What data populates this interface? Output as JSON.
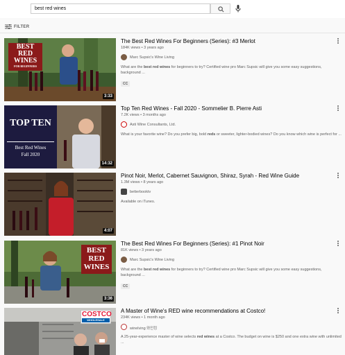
{
  "search": {
    "query": "best red wines"
  },
  "filter": {
    "label": "FILTER"
  },
  "results": [
    {
      "thumbnail_text": [
        "BEST",
        "RED",
        "WINES",
        "FOR BEGINNERS"
      ],
      "duration": "3:33",
      "title": "The Best Red Wines For Beginners (Series): #3 Merlot",
      "meta": "184K views • 3 years ago",
      "channel": "Marc Supsic's Wine Living",
      "desc_pre": "What are the ",
      "desc_bold": "best red wines",
      "desc_post": " for beginners to try? Certified wine pro Marc Supsic will give you some easy suggestions, background ...",
      "badge": "CC"
    },
    {
      "thumbnail_text": [
        "TOP TEN",
        "Best Red Wines",
        "Fall 2020"
      ],
      "duration": "14:32",
      "title": "Top Ten Red Wines - Fall 2020 - Sommelier B. Pierre Asti",
      "meta": "7.2K views • 3 months ago",
      "channel": "Asti Wine Consultants, Ltd.",
      "desc_pre": "What is your favorite wine? Do you prefer big, bold ",
      "desc_bold": "reds",
      "desc_post": " or sweeter, lighter-bodied wines? Do you know which wine is perfect for ..."
    },
    {
      "duration": "4:07",
      "title": "Pinot Noir, Merlot, Cabernet Sauvignon, Shiraz, Syrah - Red Wine Guide",
      "meta": "1.3M views • 8 years ago",
      "channel": "betterbooktv",
      "desc_pre": "Available on iTunes.",
      "desc_bold": "",
      "desc_post": ""
    },
    {
      "thumbnail_text": [
        "BEST",
        "RED",
        "WINES"
      ],
      "duration": "3:36",
      "title": "The Best Red Wines For Beginners (Series): #1 Pinot Noir",
      "meta": "81K views • 3 years ago",
      "channel": "Marc Supsic's Wine Living",
      "desc_pre": "What are the ",
      "desc_bold": "best red wines",
      "desc_post": " for beginners to try? Certified wine pro Marc Supsic will give you some easy suggestions, background ...",
      "badge": "CC"
    },
    {
      "thumbnail_text": [
        "COSTCO",
        "WHOLESALE"
      ],
      "title": "A Master of Wine's RED wine recommendations at Costco!",
      "meta": "234K views • 1 month ago",
      "channel": "winelving 와인킹",
      "desc_pre": "A 25-year-experience master of wine selects ",
      "desc_bold": "red wines",
      "desc_post": " at a Costco. The budget on wine is $250 and one extra wine with unlimited ..."
    }
  ],
  "colors": {
    "accent": "#065fd4",
    "wine_red": "#8b1a1a"
  }
}
